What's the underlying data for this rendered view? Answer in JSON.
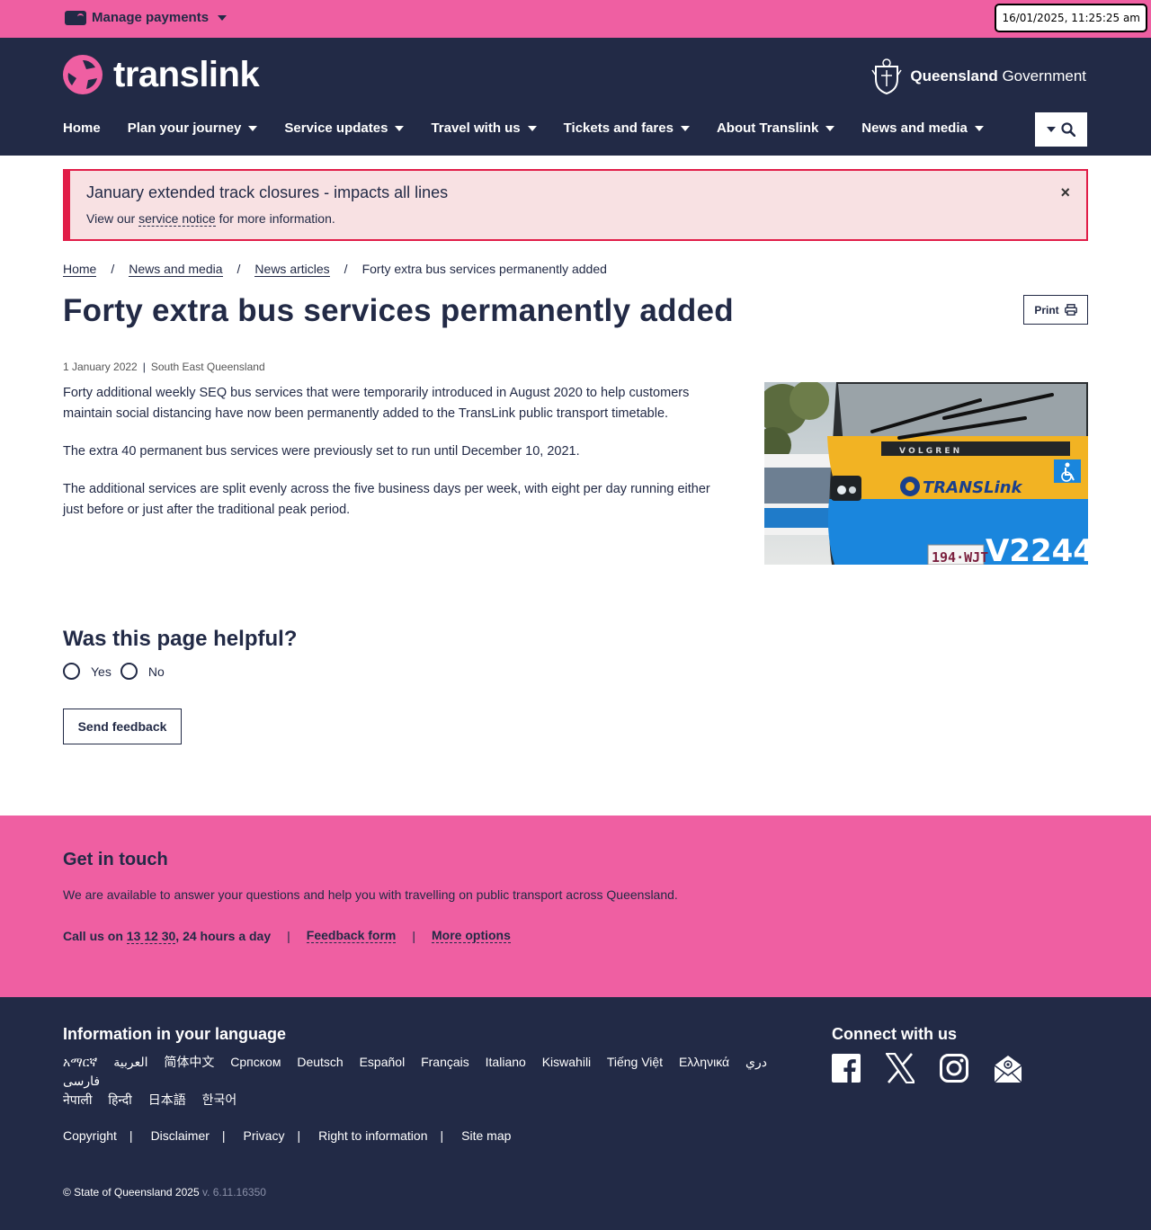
{
  "topbar": {
    "manage_payments": "Manage payments",
    "clock": "16/01/2025, 11:25:25 am"
  },
  "header": {
    "logo_text": "translink",
    "gov_bold": "Queensland",
    "gov_rest": " Government",
    "nav": [
      "Home",
      "Plan your journey",
      "Service updates",
      "Travel with us",
      "Tickets and fares",
      "About Translink",
      "News and media"
    ]
  },
  "alert": {
    "title": "January extended track closures - impacts all lines",
    "body_prefix": "View our ",
    "body_link": "service notice",
    "body_suffix": " for more information.",
    "close": "×"
  },
  "breadcrumb": [
    "Home",
    "News and media",
    "News articles",
    "Forty extra bus services permanently added"
  ],
  "article": {
    "title": "Forty extra bus services permanently added",
    "print_label": "Print",
    "date": "1 January 2022",
    "region": "South East Queensland",
    "paragraphs": [
      "Forty additional weekly SEQ bus services that were temporarily introduced in August 2020 to help customers maintain social distancing have now been permanently added to the TransLink public transport timetable.",
      "The extra 40 permanent bus services were previously set to run until December 10, 2021.",
      "The additional services are split evenly across the five business days per week, with eight per day running either just before or just after the traditional peak period."
    ],
    "photo": {
      "brand": "TRANSLink",
      "bodywork": "V O L G R E N",
      "plate": "194·WJT",
      "fleet_no": "V2244"
    }
  },
  "feedback": {
    "question": "Was this page helpful?",
    "yes": "Yes",
    "no": "No",
    "send": "Send feedback"
  },
  "get_in_touch": {
    "title": "Get in touch",
    "text": "We are available to answer your questions and help you with travelling on public transport across Queensland.",
    "call_prefix": "Call us on ",
    "phone": "13 12 30",
    "call_suffix": ", 24 hours a day",
    "feedback_form": "Feedback form",
    "more_options": "More options"
  },
  "footer": {
    "lang_title": "Information in your language",
    "languages": [
      "አማርኛ",
      "العربية",
      "简体中文",
      "Српском",
      "Deutsch",
      "Español",
      "Français",
      "Italiano",
      "Kiswahili",
      "Tiếng Việt",
      "Ελληνικά",
      "دري",
      "فارسی",
      "नेपाली",
      "हिन्दी",
      "日本語",
      "한국어"
    ],
    "connect_title": "Connect with us",
    "legal": [
      "Copyright",
      "Disclaimer",
      "Privacy",
      "Right to information",
      "Site map"
    ],
    "copyright": "© State of Queensland 2025",
    "version": "v. 6.11.16350"
  },
  "colors": {
    "brand_pink": "#ef5fa2",
    "navy": "#222a46",
    "alert_bg": "#f8e1e3",
    "alert_border": "#e11d48"
  }
}
